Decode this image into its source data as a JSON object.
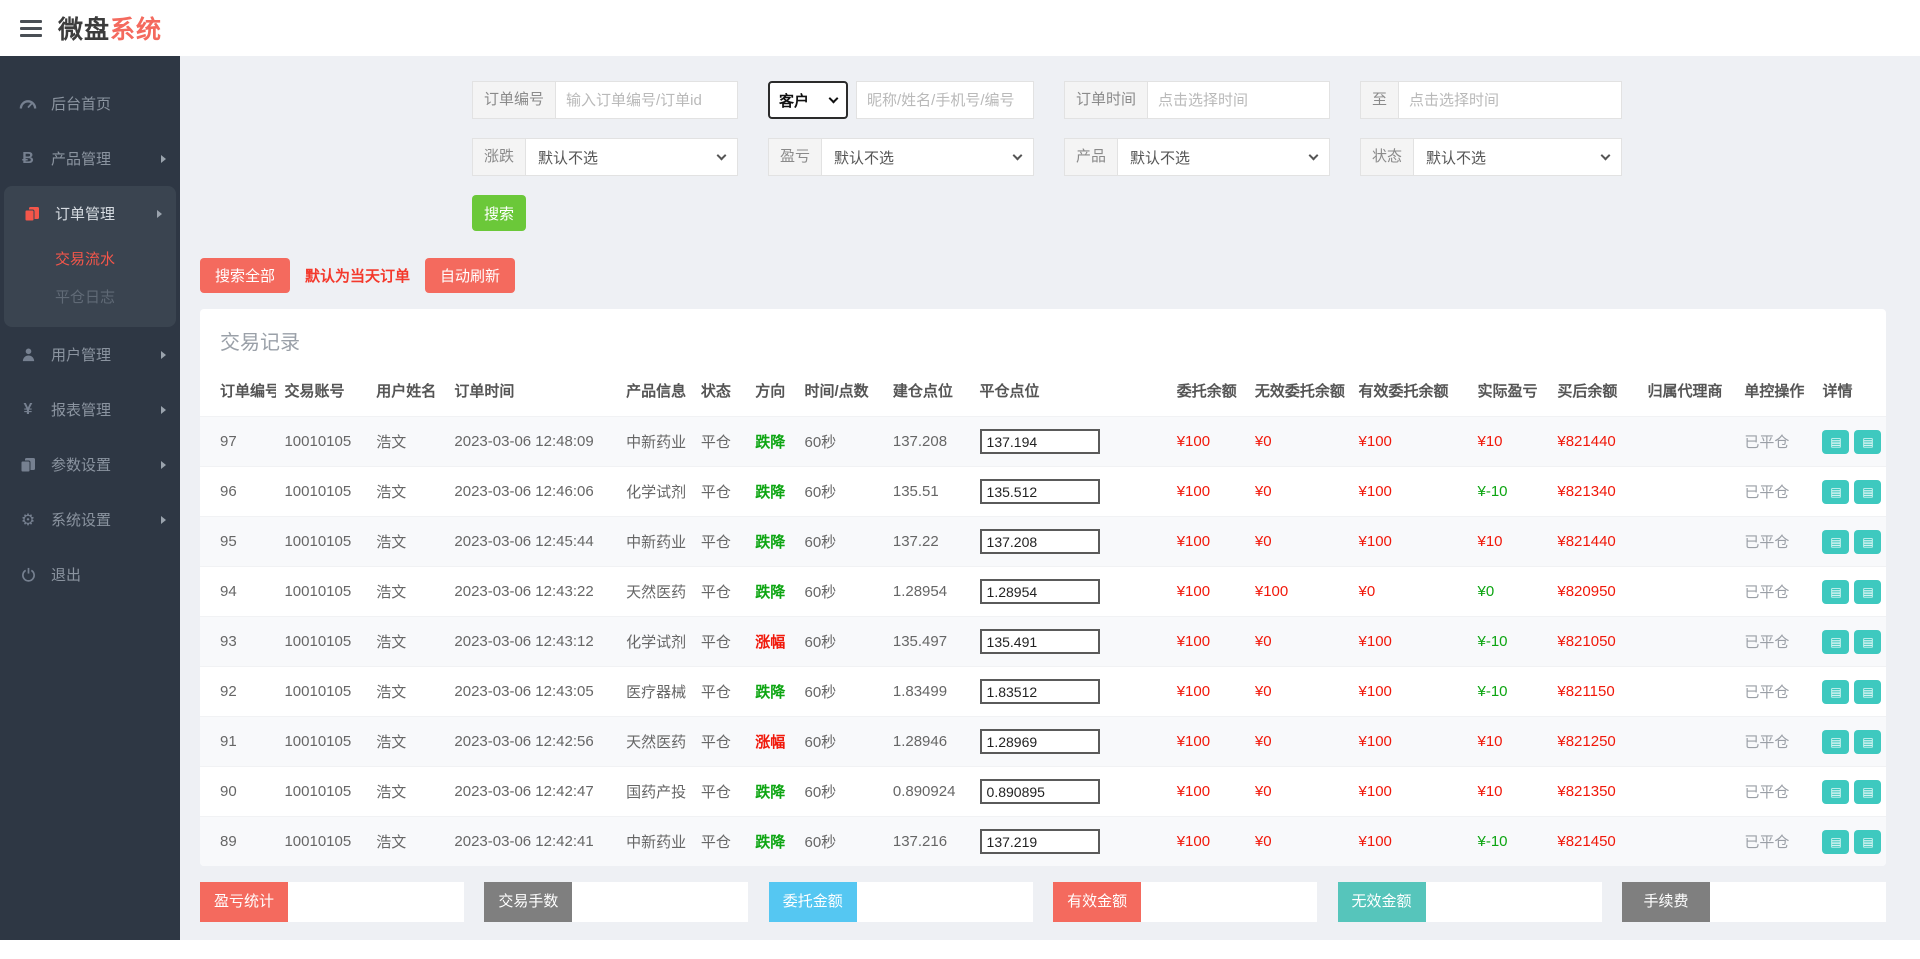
{
  "theme": {
    "salmon": "#f46a5e",
    "green_btn": "#6bc839",
    "teal": "#3ec9bf",
    "money_red": "#f1180a",
    "money_green": "#0da512"
  },
  "header": {
    "title_dark": "微盘",
    "title_red": "系统"
  },
  "sidebar": {
    "items": [
      {
        "label": "后台首页"
      },
      {
        "label": "产品管理"
      },
      {
        "label": "订单管理",
        "children": [
          {
            "label": "交易流水"
          },
          {
            "label": "平仓日志"
          }
        ]
      },
      {
        "label": "用户管理"
      },
      {
        "label": "报表管理"
      },
      {
        "label": "参数设置"
      },
      {
        "label": "系统设置"
      },
      {
        "label": "退出"
      }
    ]
  },
  "filters": {
    "order_no_label": "订单编号",
    "order_no_placeholder": "输入订单编号/订单id",
    "customer_select": "客户",
    "customer_placeholder": "昵称/姓名/手机号/编号",
    "order_time_label": "订单时间",
    "time_placeholder": "点击选择时间",
    "to_label": "至",
    "updown_label": "涨跌",
    "profit_label": "盈亏",
    "product_label": "产品",
    "status_label": "状态",
    "default_option": "默认不选",
    "search_button": "搜索"
  },
  "actions": {
    "search_all": "搜索全部",
    "today_note": "默认为当天订单",
    "auto_refresh": "自动刷新"
  },
  "table": {
    "title": "交易记录",
    "columns": [
      {
        "key": "id",
        "label": "订单编号",
        "w": "4.5%"
      },
      {
        "key": "account",
        "label": "交易账号",
        "w": "5.4%"
      },
      {
        "key": "name",
        "label": "用户姓名",
        "w": "4.6%"
      },
      {
        "key": "time",
        "label": "订单时间",
        "w": "10.1%"
      },
      {
        "key": "product",
        "label": "产品信息",
        "w": "4.4%"
      },
      {
        "key": "status",
        "label": "状态",
        "w": "3.2%"
      },
      {
        "key": "direction",
        "label": "方向",
        "w": "2.9%"
      },
      {
        "key": "duration",
        "label": "时间/点数",
        "w": "5.2%"
      },
      {
        "key": "open",
        "label": "建仓点位",
        "w": "5.1%"
      },
      {
        "key": "close",
        "label": "平仓点位",
        "w": "11.6%",
        "type": "input"
      },
      {
        "key": "entrust",
        "label": "委托余额",
        "w": "4.6%"
      },
      {
        "key": "invalid",
        "label": "无效委托余额",
        "w": "6.1%"
      },
      {
        "key": "valid",
        "label": "有效委托余额",
        "w": "7.0%"
      },
      {
        "key": "profit",
        "label": "实际盈亏",
        "w": "4.7%"
      },
      {
        "key": "after",
        "label": "买后余额",
        "w": "5.3%"
      },
      {
        "key": "agent",
        "label": "归属代理商",
        "w": "5.7%"
      },
      {
        "key": "control",
        "label": "单控操作",
        "w": "4.6%"
      },
      {
        "key": "detail",
        "label": "详情",
        "w": "4.2%",
        "type": "actions"
      }
    ],
    "rows": [
      {
        "id": "97",
        "account": "10010105",
        "name": "浩文",
        "time": "2023-03-06 12:48:09",
        "product": "中新药业",
        "status": "平仓",
        "direction": {
          "v": "跌降",
          "c": "green"
        },
        "duration": "60秒",
        "open": "137.208",
        "close": "137.194",
        "entrust": {
          "v": "¥100",
          "c": "red"
        },
        "invalid": {
          "v": "¥0",
          "c": "red"
        },
        "valid": {
          "v": "¥100",
          "c": "red"
        },
        "profit": {
          "v": "¥10",
          "c": "red"
        },
        "after": {
          "v": "¥821440",
          "c": "red"
        },
        "agent": "",
        "control": "已平仓"
      },
      {
        "id": "96",
        "account": "10010105",
        "name": "浩文",
        "time": "2023-03-06 12:46:06",
        "product": "化学试剂",
        "status": "平仓",
        "direction": {
          "v": "跌降",
          "c": "green"
        },
        "duration": "60秒",
        "open": "135.51",
        "close": "135.512",
        "entrust": {
          "v": "¥100",
          "c": "red"
        },
        "invalid": {
          "v": "¥0",
          "c": "red"
        },
        "valid": {
          "v": "¥100",
          "c": "red"
        },
        "profit": {
          "v": "¥-10",
          "c": "green"
        },
        "after": {
          "v": "¥821340",
          "c": "red"
        },
        "agent": "",
        "control": "已平仓"
      },
      {
        "id": "95",
        "account": "10010105",
        "name": "浩文",
        "time": "2023-03-06 12:45:44",
        "product": "中新药业",
        "status": "平仓",
        "direction": {
          "v": "跌降",
          "c": "green"
        },
        "duration": "60秒",
        "open": "137.22",
        "close": "137.208",
        "entrust": {
          "v": "¥100",
          "c": "red"
        },
        "invalid": {
          "v": "¥0",
          "c": "red"
        },
        "valid": {
          "v": "¥100",
          "c": "red"
        },
        "profit": {
          "v": "¥10",
          "c": "red"
        },
        "after": {
          "v": "¥821440",
          "c": "red"
        },
        "agent": "",
        "control": "已平仓"
      },
      {
        "id": "94",
        "account": "10010105",
        "name": "浩文",
        "time": "2023-03-06 12:43:22",
        "product": "天然医药",
        "status": "平仓",
        "direction": {
          "v": "跌降",
          "c": "green"
        },
        "duration": "60秒",
        "open": "1.28954",
        "close": "1.28954",
        "entrust": {
          "v": "¥100",
          "c": "red"
        },
        "invalid": {
          "v": "¥100",
          "c": "red"
        },
        "valid": {
          "v": "¥0",
          "c": "red"
        },
        "profit": {
          "v": "¥0",
          "c": "green"
        },
        "after": {
          "v": "¥820950",
          "c": "red"
        },
        "agent": "",
        "control": "已平仓"
      },
      {
        "id": "93",
        "account": "10010105",
        "name": "浩文",
        "time": "2023-03-06 12:43:12",
        "product": "化学试剂",
        "status": "平仓",
        "direction": {
          "v": "涨幅",
          "c": "red"
        },
        "duration": "60秒",
        "open": "135.497",
        "close": "135.491",
        "entrust": {
          "v": "¥100",
          "c": "red"
        },
        "invalid": {
          "v": "¥0",
          "c": "red"
        },
        "valid": {
          "v": "¥100",
          "c": "red"
        },
        "profit": {
          "v": "¥-10",
          "c": "green"
        },
        "after": {
          "v": "¥821050",
          "c": "red"
        },
        "agent": "",
        "control": "已平仓"
      },
      {
        "id": "92",
        "account": "10010105",
        "name": "浩文",
        "time": "2023-03-06 12:43:05",
        "product": "医疗器械",
        "status": "平仓",
        "direction": {
          "v": "跌降",
          "c": "green"
        },
        "duration": "60秒",
        "open": "1.83499",
        "close": "1.83512",
        "entrust": {
          "v": "¥100",
          "c": "red"
        },
        "invalid": {
          "v": "¥0",
          "c": "red"
        },
        "valid": {
          "v": "¥100",
          "c": "red"
        },
        "profit": {
          "v": "¥-10",
          "c": "green"
        },
        "after": {
          "v": "¥821150",
          "c": "red"
        },
        "agent": "",
        "control": "已平仓"
      },
      {
        "id": "91",
        "account": "10010105",
        "name": "浩文",
        "time": "2023-03-06 12:42:56",
        "product": "天然医药",
        "status": "平仓",
        "direction": {
          "v": "涨幅",
          "c": "red"
        },
        "duration": "60秒",
        "open": "1.28946",
        "close": "1.28969",
        "entrust": {
          "v": "¥100",
          "c": "red"
        },
        "invalid": {
          "v": "¥0",
          "c": "red"
        },
        "valid": {
          "v": "¥100",
          "c": "red"
        },
        "profit": {
          "v": "¥10",
          "c": "red"
        },
        "after": {
          "v": "¥821250",
          "c": "red"
        },
        "agent": "",
        "control": "已平仓"
      },
      {
        "id": "90",
        "account": "10010105",
        "name": "浩文",
        "time": "2023-03-06 12:42:47",
        "product": "国药产投",
        "status": "平仓",
        "direction": {
          "v": "跌降",
          "c": "green"
        },
        "duration": "60秒",
        "open": "0.890924",
        "close": "0.890895",
        "entrust": {
          "v": "¥100",
          "c": "red"
        },
        "invalid": {
          "v": "¥0",
          "c": "red"
        },
        "valid": {
          "v": "¥100",
          "c": "red"
        },
        "profit": {
          "v": "¥10",
          "c": "red"
        },
        "after": {
          "v": "¥821350",
          "c": "red"
        },
        "agent": "",
        "control": "已平仓"
      },
      {
        "id": "89",
        "account": "10010105",
        "name": "浩文",
        "time": "2023-03-06 12:42:41",
        "product": "中新药业",
        "status": "平仓",
        "direction": {
          "v": "跌降",
          "c": "green"
        },
        "duration": "60秒",
        "open": "137.216",
        "close": "137.219",
        "entrust": {
          "v": "¥100",
          "c": "red"
        },
        "invalid": {
          "v": "¥0",
          "c": "red"
        },
        "valid": {
          "v": "¥100",
          "c": "red"
        },
        "profit": {
          "v": "¥-10",
          "c": "green"
        },
        "after": {
          "v": "¥821450",
          "c": "red"
        },
        "agent": "",
        "control": "已平仓"
      }
    ]
  },
  "summary": {
    "items": [
      {
        "label": "盈亏统计",
        "color": "#f46a5e"
      },
      {
        "label": "交易手数",
        "color": "#7f7f7f"
      },
      {
        "label": "委托金额",
        "color": "#55c7f2"
      },
      {
        "label": "有效金额",
        "color": "#f46a5e"
      },
      {
        "label": "无效金额",
        "color": "#56c5bb"
      },
      {
        "label": "手续费",
        "color": "#7f7f7f"
      }
    ]
  }
}
